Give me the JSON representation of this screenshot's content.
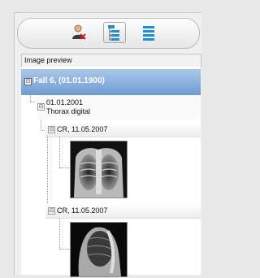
{
  "toolbar": {
    "buttons": [
      {
        "icon": "user-remove-icon",
        "active": false
      },
      {
        "icon": "tree-view-icon",
        "active": true
      },
      {
        "icon": "list-view-icon",
        "active": false
      }
    ]
  },
  "panel_header": {
    "title": "Image preview"
  },
  "tree": {
    "case": {
      "label": "Fall 6,  (01.01.1900)",
      "expanded_glyph": "⊟"
    },
    "study": {
      "date": "01.01.2001",
      "description": "Thorax digital",
      "expanded_glyph": "⊟"
    },
    "series": [
      {
        "label": "CR, 11.05.2007",
        "thumbnail": "chest-xray-frontal"
      },
      {
        "label": "CR, 11.05.2007",
        "thumbnail": "chest-xray-lateral"
      }
    ]
  },
  "colors": {
    "selection_top": "#aac8ea",
    "selection_bottom": "#6f9bd2",
    "accent_icon": "#1e8fd6"
  }
}
